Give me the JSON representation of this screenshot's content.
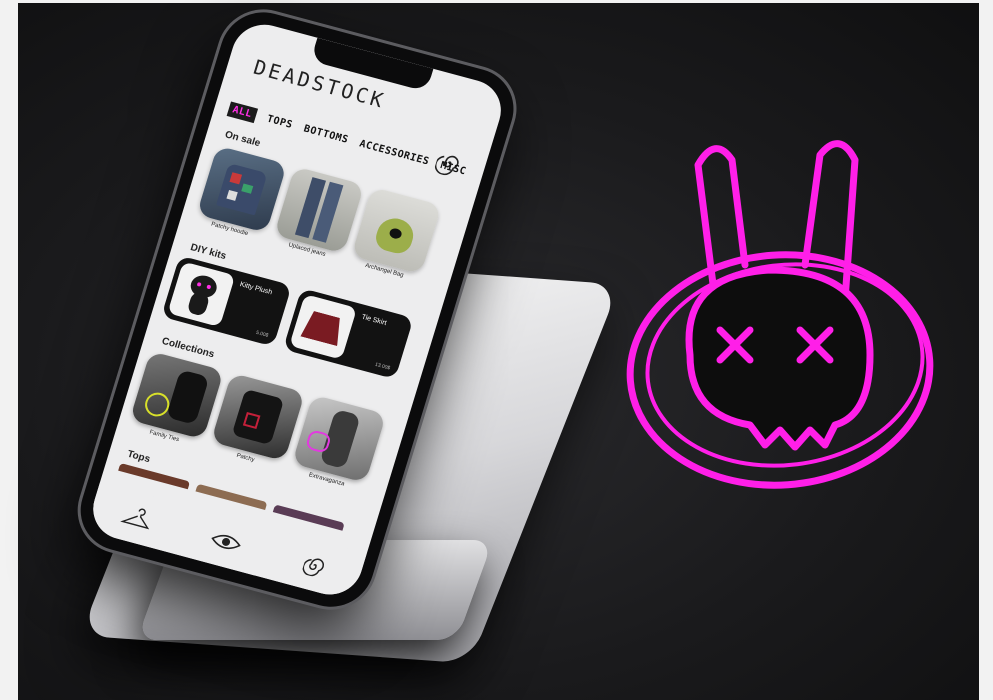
{
  "app": {
    "logo_text": "DEADSTOCK"
  },
  "categories": [
    {
      "label": "ALL",
      "active": true
    },
    {
      "label": "TOPS",
      "active": false
    },
    {
      "label": "BOTTOMS",
      "active": false
    },
    {
      "label": "ACCESSORIES",
      "active": false
    },
    {
      "label": "MISC",
      "active": false
    }
  ],
  "sections": {
    "on_sale": "On sale",
    "diy_kits": "DIY kits",
    "collections": "Collections",
    "tops": "Tops"
  },
  "on_sale_items": [
    {
      "name": "Patchy hoodie",
      "price": "",
      "sale_price": ""
    },
    {
      "name": "Uplaced jeans",
      "price": "",
      "sale_price": ""
    },
    {
      "name": "Archangel Bag",
      "price": "",
      "sale_price": ""
    }
  ],
  "diy_items": [
    {
      "name": "Kitty Plush",
      "price": "5.00$"
    },
    {
      "name": "Tie Skirt",
      "price": "13.00$"
    }
  ],
  "collections": [
    {
      "name": "Family Ties"
    },
    {
      "name": "Patchy"
    },
    {
      "name": "Extravaganza"
    }
  ],
  "tabbar": {
    "icons": [
      "hanger-icon",
      "eye-icon",
      "swirl-icon"
    ]
  },
  "colors": {
    "accent": "#ff2ee6",
    "screen_bg": "#ededee",
    "dark": "#121212",
    "backdrop": "#1c1c1e"
  }
}
